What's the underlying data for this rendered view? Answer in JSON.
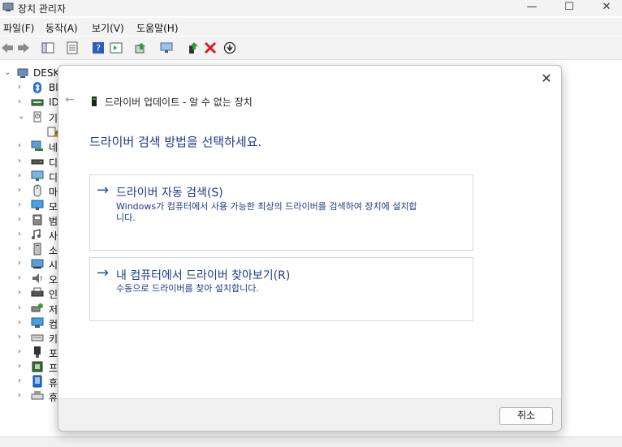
{
  "window": {
    "title": "장치 관리자",
    "minimize": "—",
    "maximize": "☐",
    "close": "✕"
  },
  "menu": {
    "items": [
      "파일(F)",
      "동작(A)",
      "보기(V)",
      "도움말(H)"
    ]
  },
  "tree": {
    "root_label": "DESKT",
    "rows": [
      {
        "label": "Bl",
        "icon": "bluetooth-icon",
        "chevron": "›"
      },
      {
        "label": "ID",
        "icon": "ide-controller-icon",
        "chevron": "›"
      },
      {
        "label": "기",
        "icon": "other-devices-icon",
        "chevron": "⌄"
      },
      {
        "label": "",
        "icon": "unknown-device-warning-icon",
        "chevron": ""
      },
      {
        "label": "네",
        "icon": "network-adapter-icon",
        "chevron": "›"
      },
      {
        "label": "디",
        "icon": "disk-drive-icon",
        "chevron": "›"
      },
      {
        "label": "디",
        "icon": "display-adapter-icon",
        "chevron": "›"
      },
      {
        "label": "마",
        "icon": "mouse-icon",
        "chevron": "›"
      },
      {
        "label": "모",
        "icon": "monitor-icon",
        "chevron": "›"
      },
      {
        "label": "범",
        "icon": "usb-controller-icon",
        "chevron": "›"
      },
      {
        "label": "사",
        "icon": "audio-io-icon",
        "chevron": "›"
      },
      {
        "label": "소",
        "icon": "software-device-icon",
        "chevron": "›"
      },
      {
        "label": "시",
        "icon": "system-device-icon",
        "chevron": "›"
      },
      {
        "label": "오",
        "icon": "speaker-icon",
        "chevron": "›"
      },
      {
        "label": "인",
        "icon": "print-queue-icon",
        "chevron": "›"
      },
      {
        "label": "저",
        "icon": "storage-controller-icon",
        "chevron": "›"
      },
      {
        "label": "컴",
        "icon": "computer-icon",
        "chevron": "›"
      },
      {
        "label": "키",
        "icon": "keyboard-icon",
        "chevron": "›"
      },
      {
        "label": "포",
        "icon": "port-icon",
        "chevron": "›"
      },
      {
        "label": "프",
        "icon": "processor-icon",
        "chevron": "›"
      },
      {
        "label": "휴",
        "icon": "portable-device-icon",
        "chevron": "›"
      },
      {
        "label": "휴",
        "icon": "hid-icon",
        "chevron": "›"
      }
    ]
  },
  "dialog": {
    "close": "✕",
    "back": "←",
    "header": "드라이버 업데이트 - 알 수 없는 장치",
    "heading": "드라이버 검색 방법을 선택하세요.",
    "options": [
      {
        "arrow": "→",
        "title": "드라이버 자동 검색(S)",
        "desc_line1": "Windows가 컴퓨터에서 사용 가능한 최상의 드라이버를 검색하여 장치에 설치합",
        "desc_line2": "니다."
      },
      {
        "arrow": "→",
        "title": "내 컴퓨터에서 드라이버 찾아보기(R)",
        "desc_line1": "수동으로 드라이버를 찾아 설치합니다."
      }
    ],
    "cancel_label": "취소"
  },
  "colors": {
    "accent": "#1e3a8a",
    "arrow": "#1e5aa8",
    "delete_red": "#d81e1e",
    "enable_green": "#2e9e3a"
  }
}
